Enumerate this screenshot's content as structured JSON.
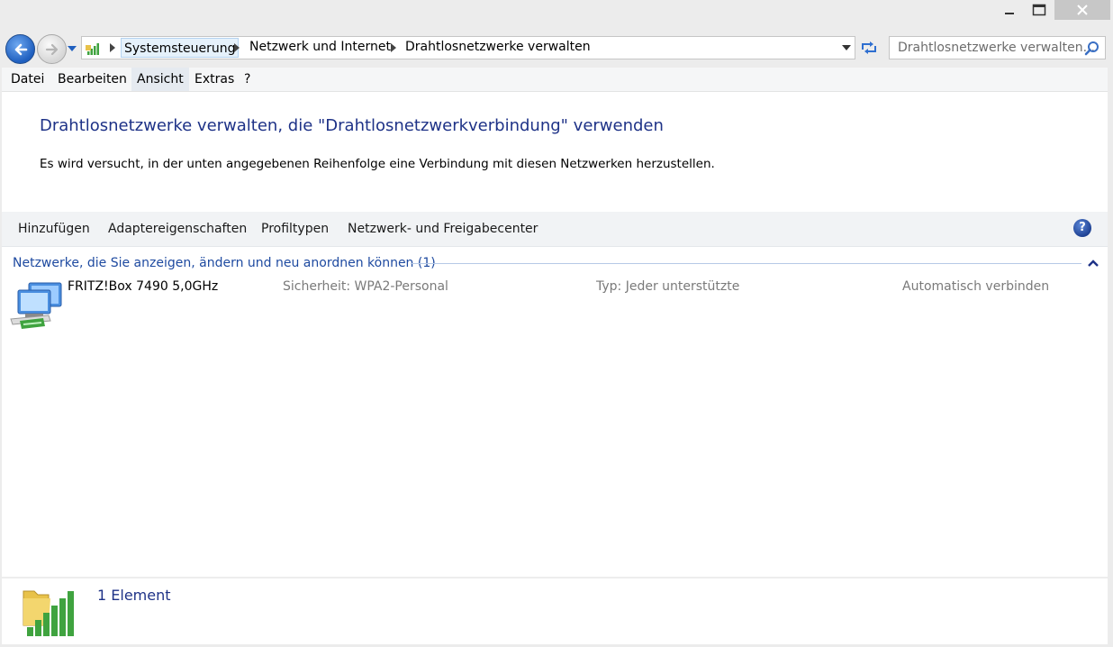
{
  "window": {
    "minimize_glyph": "—",
    "maximize_glyph": "□",
    "close_glyph": "✕"
  },
  "navigation": {
    "back_icon": "back-arrow-icon",
    "forward_icon": "forward-arrow-icon",
    "breadcrumbs": [
      "Systemsteuerung",
      "Netzwerk und Internet",
      "Drahtlosnetzwerke verwalten"
    ],
    "search_placeholder": "Drahtlosnetzwerke verwalten..."
  },
  "menu": {
    "items": [
      "Datei",
      "Bearbeiten",
      "Ansicht",
      "Extras",
      "?"
    ],
    "highlighted": "Ansicht"
  },
  "main": {
    "heading": "Drahtlosnetzwerke verwalten, die \"Drahtlosnetzwerkverbindung\" verwenden",
    "description": "Es wird versucht, in der unten angegebenen Reihenfolge eine Verbindung mit diesen Netzwerken herzustellen."
  },
  "commands": {
    "items": [
      "Hinzufügen",
      "Adaptereigenschaften",
      "Profiltypen",
      "Netzwerk- und Freigabecenter"
    ],
    "help_glyph": "?"
  },
  "group": {
    "title": "Netzwerke, die Sie anzeigen, ändern und neu anordnen können (1)"
  },
  "networks": [
    {
      "name": "FRITZ!Box 7490 5,0GHz",
      "security": "Sicherheit:  WPA2-Personal",
      "type": "Typ:  Jeder unterstützte",
      "mode": "Automatisch verbinden"
    }
  ],
  "status": {
    "count": "1 Element"
  },
  "colors": {
    "heading_blue": "#1e3287",
    "group_blue": "#1e4aa0",
    "close_button": "#c7c7c7",
    "signal_green": "#3fa33f"
  }
}
